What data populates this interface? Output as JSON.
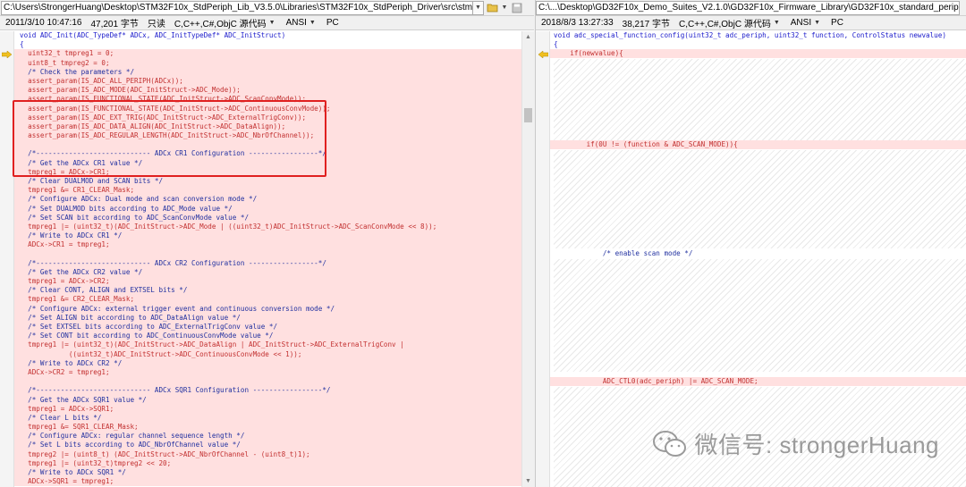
{
  "left": {
    "path": "C:\\Users\\StrongerHuang\\Desktop\\STM32F10x_StdPeriph_Lib_V3.5.0\\Libraries\\STM32F10x_StdPeriph_Driver\\src\\stm32f10x_adc.c",
    "info": {
      "datetime": "2011/3/10 10:47:16",
      "size": "47,201 字节",
      "readonly": "只读",
      "language": "C,C++,C#,ObjC 源代码",
      "encoding": "ANSI",
      "line_ending": "PC"
    },
    "lines": [
      "void ADC_Init(ADC_TypeDef* ADCx, ADC_InitTypeDef* ADC_InitStruct)",
      "{",
      "  uint32_t tmpreg1 = 0;",
      "  uint8_t tmpreg2 = 0;",
      "  /* Check the parameters */",
      "  assert_param(IS_ADC_ALL_PERIPH(ADCx));",
      "  assert_param(IS_ADC_MODE(ADC_InitStruct->ADC_Mode));",
      "  assert_param(IS_FUNCTIONAL_STATE(ADC_InitStruct->ADC_ScanConvMode));",
      "  assert_param(IS_FUNCTIONAL_STATE(ADC_InitStruct->ADC_ContinuousConvMode));",
      "  assert_param(IS_ADC_EXT_TRIG(ADC_InitStruct->ADC_ExternalTrigConv));",
      "  assert_param(IS_ADC_DATA_ALIGN(ADC_InitStruct->ADC_DataAlign));",
      "  assert_param(IS_ADC_REGULAR_LENGTH(ADC_InitStruct->ADC_NbrOfChannel));",
      "",
      "  /*---------------------------- ADCx CR1 Configuration -----------------*/",
      "  /* Get the ADCx CR1 value */",
      "  tmpreg1 = ADCx->CR1;",
      "  /* Clear DUALMOD and SCAN bits */",
      "  tmpreg1 &= CR1_CLEAR_Mask;",
      "  /* Configure ADCx: Dual mode and scan conversion mode */",
      "  /* Set DUALMOD bits according to ADC_Mode value */",
      "  /* Set SCAN bit according to ADC_ScanConvMode value */",
      "  tmpreg1 |= (uint32_t)(ADC_InitStruct->ADC_Mode | ((uint32_t)ADC_InitStruct->ADC_ScanConvMode << 8));",
      "  /* Write to ADCx CR1 */",
      "  ADCx->CR1 = tmpreg1;",
      "",
      "  /*---------------------------- ADCx CR2 Configuration -----------------*/",
      "  /* Get the ADCx CR2 value */",
      "  tmpreg1 = ADCx->CR2;",
      "  /* Clear CONT, ALIGN and EXTSEL bits */",
      "  tmpreg1 &= CR2_CLEAR_Mask;",
      "  /* Configure ADCx: external trigger event and continuous conversion mode */",
      "  /* Set ALIGN bit according to ADC_DataAlign value */",
      "  /* Set EXTSEL bits according to ADC_ExternalTrigConv value */",
      "  /* Set CONT bit according to ADC_ContinuousConvMode value */",
      "  tmpreg1 |= (uint32_t)(ADC_InitStruct->ADC_DataAlign | ADC_InitStruct->ADC_ExternalTrigConv |",
      "            ((uint32_t)ADC_InitStruct->ADC_ContinuousConvMode << 1));",
      "  /* Write to ADCx CR2 */",
      "  ADCx->CR2 = tmpreg1;",
      "",
      "  /*---------------------------- ADCx SQR1 Configuration -----------------*/",
      "  /* Get the ADCx SQR1 value */",
      "  tmpreg1 = ADCx->SQR1;",
      "  /* Clear L bits */",
      "  tmpreg1 &= SQR1_CLEAR_Mask;",
      "  /* Configure ADCx: regular channel sequence length */",
      "  /* Set L bits according to ADC_NbrOfChannel value */",
      "  tmpreg2 |= (uint8_t) (ADC_InitStruct->ADC_NbrOfChannel - (uint8_t)1);",
      "  tmpreg1 |= (uint32_t)tmpreg2 << 20;",
      "  /* Write to ADCx SQR1 */",
      "  ADCx->SQR1 = tmpreg1;"
    ]
  },
  "right": {
    "path": "C:\\...\\Desktop\\GD32F10x_Demo_Suites_V2.1.0\\GD32F10x_Firmware_Library\\GD32F10x_standard_peripheral\\Source\\gd32f10x_adc.c",
    "info": {
      "datetime": "2018/8/3 13:27:33",
      "size": "38,217 字节",
      "language": "C,C++,C#,ObjC 源代码",
      "encoding": "ANSI",
      "line_ending": "PC"
    },
    "lines": {
      "l1": "void adc_special_function_config(uint32_t adc_periph, uint32_t function, ControlStatus newvalue)",
      "l2": "{",
      "l3": "    if(newvalue){",
      "l4": "        if(0U != (function & ADC_SCAN_MODE)){",
      "l5": "            /* enable scan mode */",
      "l6": "            ADC_CTL0(adc_periph) |= ADC_SCAN_MODE;"
    }
  },
  "watermark": "微信号: strongerHuang"
}
